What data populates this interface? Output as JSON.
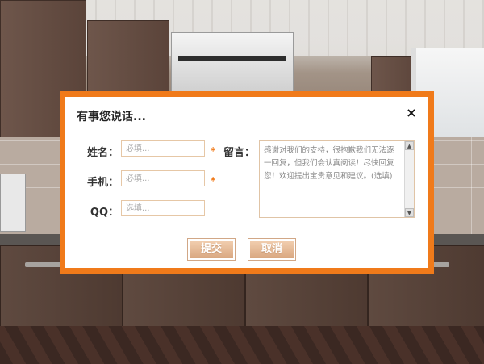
{
  "dialog": {
    "title": "有事您说话...",
    "close_label": "×"
  },
  "form": {
    "name": {
      "label": "姓名：",
      "placeholder": "必填...",
      "required_mark": "*"
    },
    "phone": {
      "label": "手机：",
      "placeholder": "必填...",
      "required_mark": "*"
    },
    "qq": {
      "label": "QQ：",
      "placeholder": "选填..."
    },
    "message": {
      "label": "留言：",
      "text": "感谢对我们的支持，很抱歉我们无法逐一回复，但我们会认真阅读！尽快回复您！欢迎提出宝贵意见和建议。(选填)"
    }
  },
  "buttons": {
    "submit": "提交",
    "cancel": "取消"
  },
  "colors": {
    "frame": "#f07a1a",
    "button": "#e2b48e"
  },
  "icons": {
    "scroll_up": "▲",
    "scroll_down": "▼"
  }
}
